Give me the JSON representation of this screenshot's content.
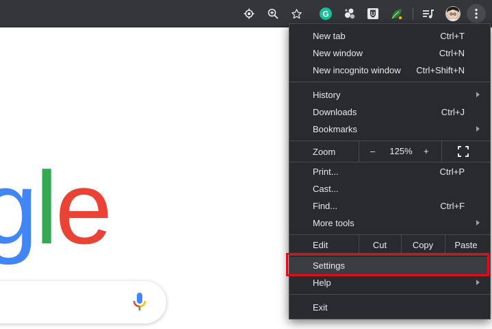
{
  "toolbar": {
    "icons": [
      "location-target-icon",
      "zoom-icon",
      "bookmark-star-icon",
      "grammarly-extension-icon",
      "puzzle-extension-icon",
      "password-manager-extension-icon",
      "leaf-extension-icon",
      "media-queue-icon",
      "profile-avatar",
      "more-menu-icon"
    ],
    "grammarly_letter": "G",
    "bitwarden_letter": "U"
  },
  "logo": {
    "letters": [
      "g",
      "l",
      "e"
    ],
    "colors": [
      "#4285f4",
      "#34a853",
      "#ea4335"
    ]
  },
  "menu": {
    "new_tab": {
      "label": "New tab",
      "shortcut": "Ctrl+T"
    },
    "new_window": {
      "label": "New window",
      "shortcut": "Ctrl+N"
    },
    "new_incognito": {
      "label": "New incognito window",
      "shortcut": "Ctrl+Shift+N"
    },
    "history": {
      "label": "History"
    },
    "downloads": {
      "label": "Downloads",
      "shortcut": "Ctrl+J"
    },
    "bookmarks": {
      "label": "Bookmarks"
    },
    "zoom": {
      "label": "Zoom",
      "minus": "–",
      "value": "125%",
      "plus": "+"
    },
    "print": {
      "label": "Print...",
      "shortcut": "Ctrl+P"
    },
    "cast": {
      "label": "Cast..."
    },
    "find": {
      "label": "Find...",
      "shortcut": "Ctrl+F"
    },
    "more_tools": {
      "label": "More tools"
    },
    "edit": {
      "label": "Edit",
      "cut": "Cut",
      "copy": "Copy",
      "paste": "Paste"
    },
    "settings": {
      "label": "Settings"
    },
    "help": {
      "label": "Help"
    },
    "exit": {
      "label": "Exit"
    }
  },
  "colors": {
    "menu_bg": "#292a2d",
    "toolbar_bg": "#35363a",
    "highlight_border": "#e10c1a"
  }
}
